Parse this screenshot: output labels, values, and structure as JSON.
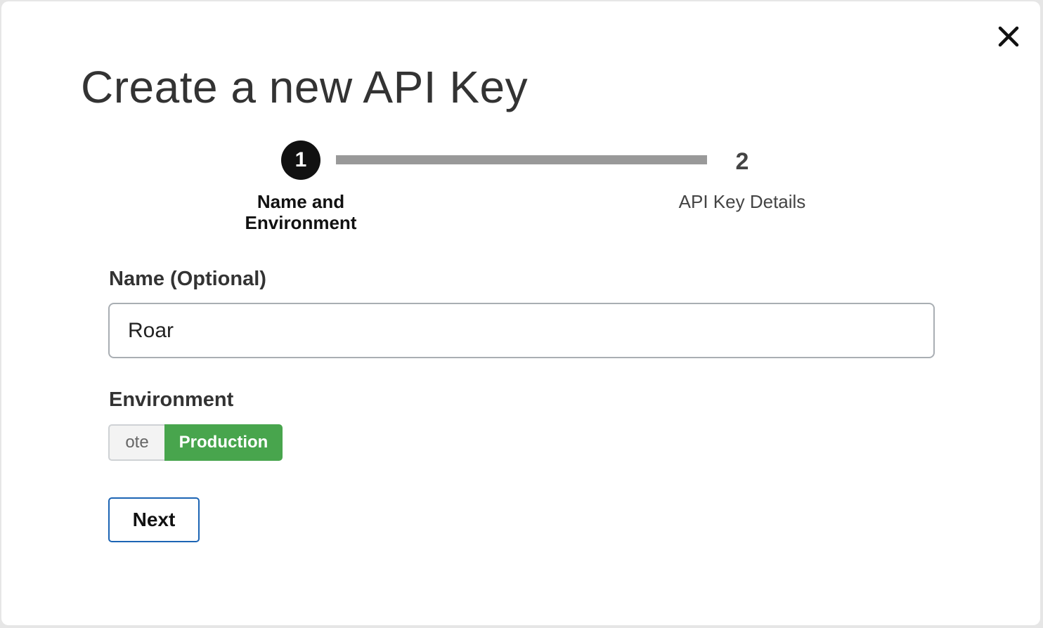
{
  "modal": {
    "title": "Create a new API Key",
    "close_icon": "close-icon"
  },
  "stepper": {
    "steps": [
      {
        "number": "1",
        "label": "Name and Environment",
        "state": "active"
      },
      {
        "number": "2",
        "label": "API Key Details",
        "state": "upcoming"
      }
    ]
  },
  "form": {
    "name_label": "Name (Optional)",
    "name_value": "Roar",
    "environment_label": "Environment",
    "environment_options": [
      "ote",
      "Production"
    ],
    "environment_selected": "Production",
    "next_label": "Next"
  },
  "colors": {
    "selected_option": "#48a54d",
    "button_border": "#1c64b4",
    "active_step": "#111111",
    "progress_track": "#999999"
  }
}
